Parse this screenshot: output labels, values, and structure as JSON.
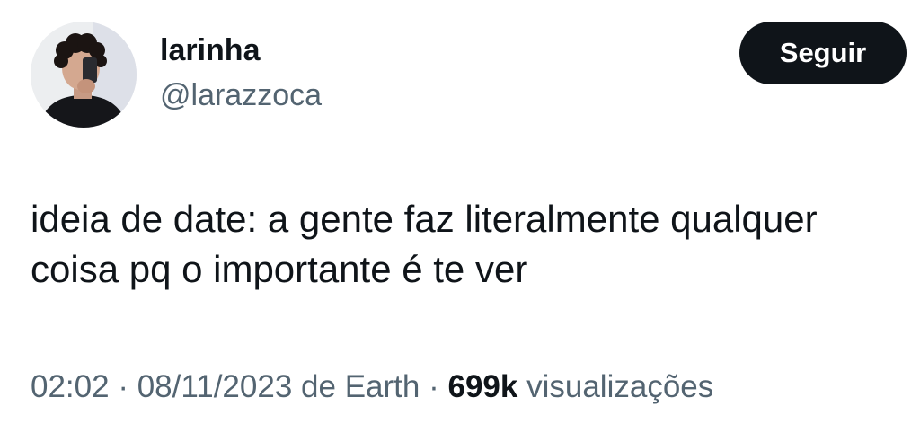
{
  "author": {
    "display_name": "larinha",
    "handle": "@larazzoca",
    "avatar_icon": "profile-photo"
  },
  "follow_button": {
    "label": "Seguir",
    "bg_color": "#0f1419",
    "text_color": "#ffffff"
  },
  "tweet": {
    "text_line1": "ideia de date: a gente faz literalmente qualquer",
    "text_line2": "coisa pq o importante é te ver"
  },
  "meta": {
    "time": "02:02",
    "separator": "·",
    "date": "08/11/2023",
    "source_prefix": "de",
    "source": "Earth",
    "views_count": "699k",
    "views_label": "visualizações"
  },
  "colors": {
    "text_primary": "#0f1419",
    "text_secondary": "#536471",
    "background": "#ffffff"
  }
}
